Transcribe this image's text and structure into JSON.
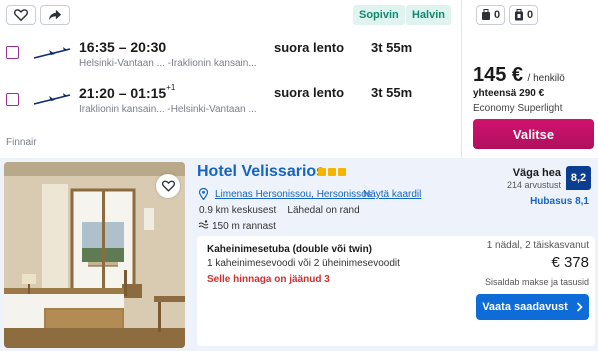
{
  "flight": {
    "tags": [
      "Sopivin",
      "Halvin"
    ],
    "legs": [
      {
        "times": "16:35 – 20:30",
        "day_offset": "",
        "airports": "Helsinki-Vantaan ... -Iraklionin kansain...",
        "type": "suora lento",
        "duration": "3t 55m"
      },
      {
        "times": "21:20 – 01:15",
        "day_offset": "+1",
        "airports": "Iraklionin kansain... -Helsinki-Vantaan ...",
        "type": "suora lento",
        "duration": "3t 55m"
      }
    ],
    "airline": "Finnair",
    "bags": [
      {
        "icon": "personal-item-icon",
        "count": "0"
      },
      {
        "icon": "cabin-bag-icon",
        "count": "0"
      }
    ],
    "price": "145 €",
    "price_unit": "/ henkilö",
    "total": "yhteensä 290 €",
    "fare_class": "Economy Superlight",
    "select_label": "Valitse",
    "accent": "#c2185b"
  },
  "hotel": {
    "name": "Hotel Velissarios",
    "star_count": 3,
    "location": "Limenas Hersonissou, Hersonissos",
    "map_link": "Näytä kaardil",
    "distance_center": "0.9 km keskusest",
    "beach_info": "Lähedal on rand",
    "beach_distance": "150 m rannast",
    "rating_label": "Väga hea",
    "review_count": "214 arvustust",
    "rating": "8,2",
    "hygiene": "Hubasus 8,1",
    "room": {
      "name": "Kaheinimesetuba (double või twin)",
      "beds": "1 kaheinimesevoodi või 2 üheinimesevoodit",
      "scarcity": "Selle hinnaga on jäänud 3"
    },
    "stay_info": "1 nädal, 2 täiskasvanut",
    "price": "€ 378",
    "taxes": "Sisaldab makse ja tasusid",
    "cta": "Vaata saadavust",
    "accent": "#0d6cd8"
  }
}
